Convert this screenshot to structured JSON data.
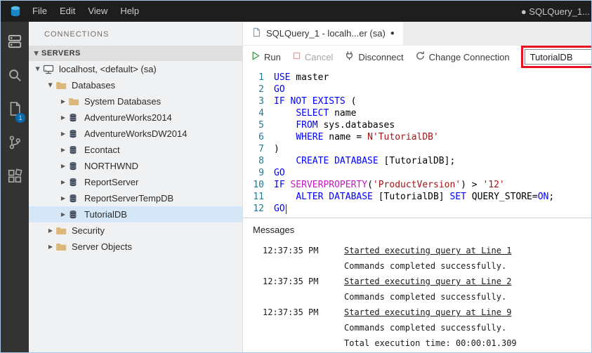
{
  "window": {
    "menus": [
      "File",
      "Edit",
      "View",
      "Help"
    ],
    "title_right": "● SQLQuery_1..."
  },
  "activity_bar": {
    "items": [
      {
        "name": "connections",
        "icon": "servers-icon",
        "active": true
      },
      {
        "name": "search",
        "icon": "search-icon"
      },
      {
        "name": "task-history",
        "icon": "file-icon",
        "badge": "1"
      },
      {
        "name": "source-control",
        "icon": "branch-icon"
      },
      {
        "name": "extensions",
        "icon": "extensions-icon"
      }
    ]
  },
  "sidebar": {
    "title": "CONNECTIONS",
    "section_header": "SERVERS",
    "tree": [
      {
        "label": "localhost, <default> (sa)",
        "icon": "server",
        "level": 0,
        "state": "expanded"
      },
      {
        "label": "Databases",
        "icon": "folder",
        "level": 1,
        "state": "expanded"
      },
      {
        "label": "System Databases",
        "icon": "folder",
        "level": 2,
        "state": "collapsed"
      },
      {
        "label": "AdventureWorks2014",
        "icon": "database",
        "level": 2,
        "state": "collapsed"
      },
      {
        "label": "AdventureWorksDW2014",
        "icon": "database",
        "level": 2,
        "state": "collapsed"
      },
      {
        "label": "Econtact",
        "icon": "database",
        "level": 2,
        "state": "collapsed"
      },
      {
        "label": "NORTHWND",
        "icon": "database",
        "level": 2,
        "state": "collapsed"
      },
      {
        "label": "ReportServer",
        "icon": "database",
        "level": 2,
        "state": "collapsed"
      },
      {
        "label": "ReportServerTempDB",
        "icon": "database",
        "level": 2,
        "state": "collapsed"
      },
      {
        "label": "TutorialDB",
        "icon": "database",
        "level": 2,
        "state": "collapsed",
        "selected": true
      },
      {
        "label": "Security",
        "icon": "folder",
        "level": 1,
        "state": "collapsed"
      },
      {
        "label": "Server Objects",
        "icon": "folder",
        "level": 1,
        "state": "collapsed"
      }
    ]
  },
  "editor": {
    "tab_label": "SQLQuery_1 - localh...er (sa)",
    "tab_dirty": "●",
    "toolbar": {
      "run_label": "Run",
      "cancel_label": "Cancel",
      "disconnect_label": "Disconnect",
      "change_connection_label": "Change Connection",
      "database_dropdown_value": "TutorialDB"
    },
    "code_lines": [
      {
        "num": 1,
        "tokens": [
          {
            "t": "USE",
            "c": "keyword"
          },
          {
            "t": " master",
            "c": "plain"
          }
        ]
      },
      {
        "num": 2,
        "tokens": [
          {
            "t": "GO",
            "c": "keyword"
          }
        ]
      },
      {
        "num": 3,
        "tokens": [
          {
            "t": "IF NOT EXISTS",
            "c": "keyword"
          },
          {
            "t": " (",
            "c": "plain"
          }
        ]
      },
      {
        "num": 4,
        "tokens": [
          {
            "t": "    ",
            "c": "plain"
          },
          {
            "t": "SELECT",
            "c": "keyword"
          },
          {
            "t": " name",
            "c": "plain"
          }
        ]
      },
      {
        "num": 5,
        "tokens": [
          {
            "t": "    ",
            "c": "plain"
          },
          {
            "t": "FROM",
            "c": "keyword"
          },
          {
            "t": " sys.databases",
            "c": "plain"
          }
        ]
      },
      {
        "num": 6,
        "tokens": [
          {
            "t": "    ",
            "c": "plain"
          },
          {
            "t": "WHERE",
            "c": "keyword"
          },
          {
            "t": " name = ",
            "c": "plain"
          },
          {
            "t": "N'TutorialDB'",
            "c": "string"
          }
        ]
      },
      {
        "num": 7,
        "tokens": [
          {
            "t": ")",
            "c": "plain"
          }
        ]
      },
      {
        "num": 8,
        "tokens": [
          {
            "t": "    ",
            "c": "plain"
          },
          {
            "t": "CREATE DATABASE",
            "c": "keyword"
          },
          {
            "t": " [TutorialDB];",
            "c": "plain"
          }
        ]
      },
      {
        "num": 9,
        "tokens": [
          {
            "t": "GO",
            "c": "keyword"
          }
        ]
      },
      {
        "num": 10,
        "tokens": [
          {
            "t": "IF",
            "c": "keyword"
          },
          {
            "t": " ",
            "c": "plain"
          },
          {
            "t": "SERVERPROPERTY",
            "c": "function"
          },
          {
            "t": "(",
            "c": "plain"
          },
          {
            "t": "'ProductVersion'",
            "c": "string"
          },
          {
            "t": ") > ",
            "c": "plain"
          },
          {
            "t": "'12'",
            "c": "string"
          }
        ]
      },
      {
        "num": 11,
        "tokens": [
          {
            "t": "    ",
            "c": "plain"
          },
          {
            "t": "ALTER DATABASE",
            "c": "keyword"
          },
          {
            "t": " [TutorialDB] ",
            "c": "plain"
          },
          {
            "t": "SET",
            "c": "keyword"
          },
          {
            "t": " QUERY_STORE=",
            "c": "plain"
          },
          {
            "t": "ON",
            "c": "keyword"
          },
          {
            "t": ";",
            "c": "plain"
          }
        ]
      },
      {
        "num": 12,
        "tokens": [
          {
            "t": "GO",
            "c": "keyword"
          }
        ],
        "cursor": true
      }
    ],
    "messages": {
      "title": "Messages",
      "entries": [
        {
          "time": "12:37:35 PM",
          "link": "Started executing query at Line 1",
          "result": "Commands completed successfully."
        },
        {
          "time": "12:37:35 PM",
          "link": "Started executing query at Line 2",
          "result": "Commands completed successfully."
        },
        {
          "time": "12:37:35 PM",
          "link": "Started executing query at Line 9",
          "result": "Commands completed successfully."
        }
      ],
      "total": "Total execution time: 00:00:01.309"
    }
  },
  "colors": {
    "plain": "#000000",
    "keyword": "#0000ff",
    "string": "#a31515",
    "function": "#c717c7",
    "line_number": "#237893",
    "badge": "#007acc",
    "annotation": "#e81123",
    "selection_bg": "#d5e6f7"
  }
}
